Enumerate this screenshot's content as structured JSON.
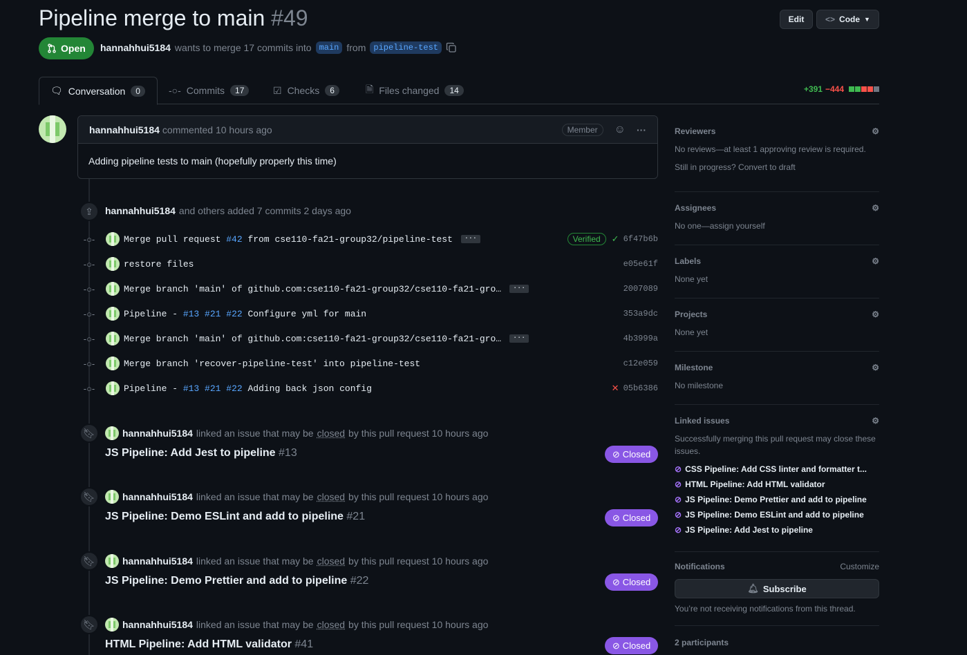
{
  "pr": {
    "title": "Pipeline merge to main",
    "number": "#49",
    "state": "Open",
    "author": "hannahhui5184",
    "wants_text": "wants to merge 17 commits into",
    "base_branch": "main",
    "from_text": "from",
    "head_branch": "pipeline-test"
  },
  "header_buttons": {
    "edit": "Edit",
    "code": "Code"
  },
  "tabs": [
    {
      "label": "Conversation",
      "count": "0"
    },
    {
      "label": "Commits",
      "count": "17"
    },
    {
      "label": "Checks",
      "count": "6"
    },
    {
      "label": "Files changed",
      "count": "14"
    }
  ],
  "diffstat": {
    "additions": "+391",
    "deletions": "−444"
  },
  "comment": {
    "author": "hannahhui5184",
    "action": "commented 10 hours ago",
    "role": "Member",
    "body": "Adding pipeline tests to main (hopefully properly this time)"
  },
  "commits_event": {
    "author": "hannahhui5184",
    "text": "and others added 7 commits 2 days ago"
  },
  "commits": [
    {
      "prefix": "Merge pull request ",
      "link": "#42",
      "suffix": " from cse110-fa21-group32/pipeline-test",
      "more": true,
      "verified": "Verified",
      "status": "check",
      "sha": "6f47b6b"
    },
    {
      "prefix": "restore files",
      "link": "",
      "suffix": "",
      "more": false,
      "verified": "",
      "status": "",
      "sha": "e05e61f"
    },
    {
      "prefix": "Merge branch 'main' of github.com:cse110-fa21-group32/cse110-fa21-gro…",
      "link": "",
      "suffix": "",
      "more": true,
      "verified": "",
      "status": "",
      "sha": "2007089"
    },
    {
      "prefix": "Pipeline - ",
      "link": "#13 #21 #22",
      "suffix": " Configure yml for main",
      "more": false,
      "verified": "",
      "status": "",
      "sha": "353a9dc"
    },
    {
      "prefix": "Merge branch 'main' of github.com:cse110-fa21-group32/cse110-fa21-gro…",
      "link": "",
      "suffix": "",
      "more": true,
      "verified": "",
      "status": "",
      "sha": "4b3999a"
    },
    {
      "prefix": "Merge branch 'recover-pipeline-test' into pipeline-test",
      "link": "",
      "suffix": "",
      "more": false,
      "verified": "",
      "status": "",
      "sha": "c12e059"
    },
    {
      "prefix": "Pipeline - ",
      "link": "#13 #21 #22",
      "suffix": " Adding back json config",
      "more": false,
      "verified": "",
      "status": "x",
      "sha": "05b6386"
    }
  ],
  "linked_events": [
    {
      "author": "hannahhui5184",
      "text1": "linked an issue that may be",
      "closed_word": "closed",
      "text2": "by this pull request 10 hours ago",
      "title": "JS Pipeline: Add Jest to pipeline",
      "num": "#13",
      "badge": "Closed"
    },
    {
      "author": "hannahhui5184",
      "text1": "linked an issue that may be",
      "closed_word": "closed",
      "text2": "by this pull request 10 hours ago",
      "title": "JS Pipeline: Demo ESLint and add to pipeline",
      "num": "#21",
      "badge": "Closed"
    },
    {
      "author": "hannahhui5184",
      "text1": "linked an issue that may be",
      "closed_word": "closed",
      "text2": "by this pull request 10 hours ago",
      "title": "JS Pipeline: Demo Prettier and add to pipeline",
      "num": "#22",
      "badge": "Closed"
    },
    {
      "author": "hannahhui5184",
      "text1": "linked an issue that may be",
      "closed_word": "closed",
      "text2": "by this pull request 10 hours ago",
      "title": "HTML Pipeline: Add HTML validator",
      "num": "#41",
      "badge": "Closed"
    }
  ],
  "sidebar": {
    "reviewers": {
      "title": "Reviewers",
      "text": "No reviews—at least 1 approving review is required.",
      "draft": "Still in progress? Convert to draft"
    },
    "assignees": {
      "title": "Assignees",
      "text": "No one—assign yourself"
    },
    "labels": {
      "title": "Labels",
      "text": "None yet"
    },
    "projects": {
      "title": "Projects",
      "text": "None yet"
    },
    "milestone": {
      "title": "Milestone",
      "text": "No milestone"
    },
    "linked_issues": {
      "title": "Linked issues",
      "text": "Successfully merging this pull request may close these issues.",
      "items": [
        "CSS Pipeline: Add CSS linter and formatter t...",
        "HTML Pipeline: Add HTML validator",
        "JS Pipeline: Demo Prettier and add to pipeline",
        "JS Pipeline: Demo ESLint and add to pipeline",
        "JS Pipeline: Add Jest to pipeline"
      ]
    },
    "notifications": {
      "title": "Notifications",
      "customize": "Customize",
      "subscribe": "Subscribe",
      "text": "You’re not receiving notifications from this thread."
    },
    "participants": "2 participants"
  },
  "colors": {
    "open": "#238636",
    "closed": "#8957e5",
    "link": "#58a6ff",
    "add": "#3fb950",
    "del": "#f85149"
  }
}
